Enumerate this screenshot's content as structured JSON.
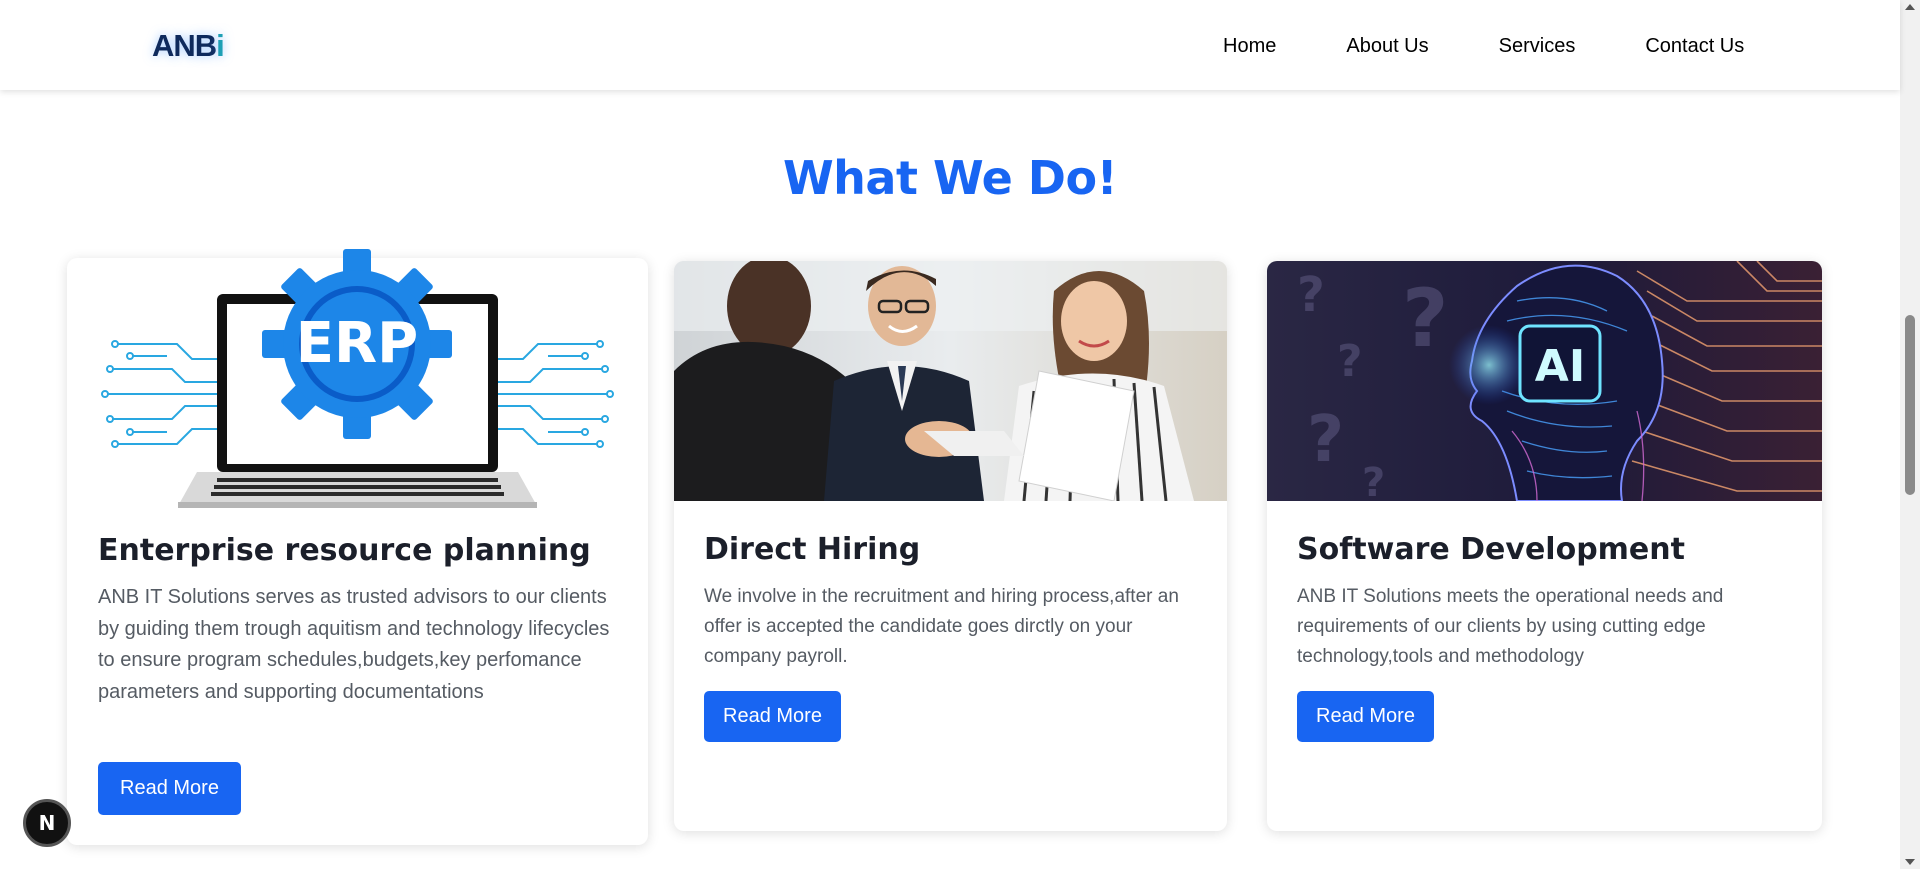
{
  "navbar": {
    "logo_text": "ANB",
    "logo_accent": "i",
    "links": [
      "Home",
      "About Us",
      "Services",
      "Contact Us"
    ]
  },
  "section": {
    "title": "What We Do!"
  },
  "cards": [
    {
      "image_label": "ERP",
      "title": "Enterprise resource planning",
      "text": "ANB IT Solutions serves as trusted advisors to our clients by guiding them trough aquitism and technology lifecycles to ensure program schedules,budgets,key perfomance parameters and supporting documentations",
      "button": "Read More"
    },
    {
      "title": "Direct Hiring",
      "text": "We involve in the recruitment and hiring process,after an offer is accepted the candidate goes dirctly on your company payroll.",
      "button": "Read More"
    },
    {
      "image_label": "AI",
      "title": "Software Development",
      "text": "ANB IT Solutions meets the operational needs and requirements of our clients by using cutting edge technology,tools and methodology",
      "button": "Read More"
    }
  ],
  "floating_badge": "N",
  "colors": {
    "accent": "#1865f2",
    "heading": "#1b1f2a",
    "body_text": "#555b63"
  }
}
